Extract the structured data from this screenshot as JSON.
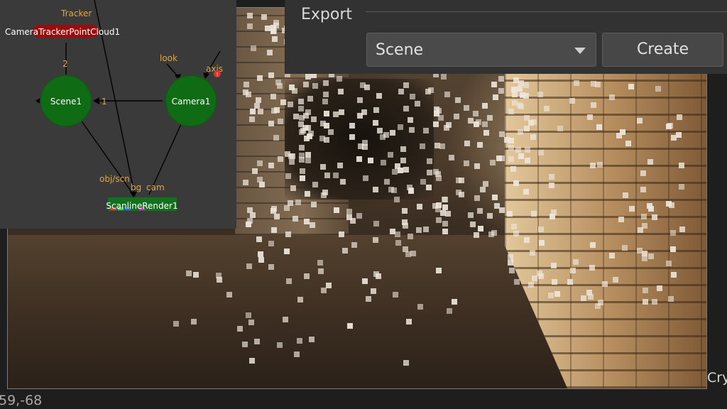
{
  "export_panel": {
    "title": "Export",
    "selected_option": "Scene",
    "create_label": "Create"
  },
  "node_graph": {
    "nodes": {
      "tracker_cloud": "CameraTrackerPointCloud1",
      "scene": "Scene1",
      "camera": "Camera1",
      "render": "ScanlineRender1"
    },
    "pins": {
      "tracker": "Tracker",
      "scene_input": "2",
      "scene_cam_input": "1",
      "look": "look",
      "axis": "axis",
      "obj_scn": "obj/scn",
      "bg": "bg",
      "cam": "cam"
    },
    "colors": {
      "graph_bg": "#3a3a3a",
      "scene_node": "#0f6b14",
      "camera_node": "#0f6b14",
      "render_node": "#13701c",
      "tracker_node": "#9a0d0d",
      "pin_label": "#e3a641"
    }
  },
  "viewer": {
    "coordinates": "59,-68",
    "right_edge_text": "Cry"
  }
}
